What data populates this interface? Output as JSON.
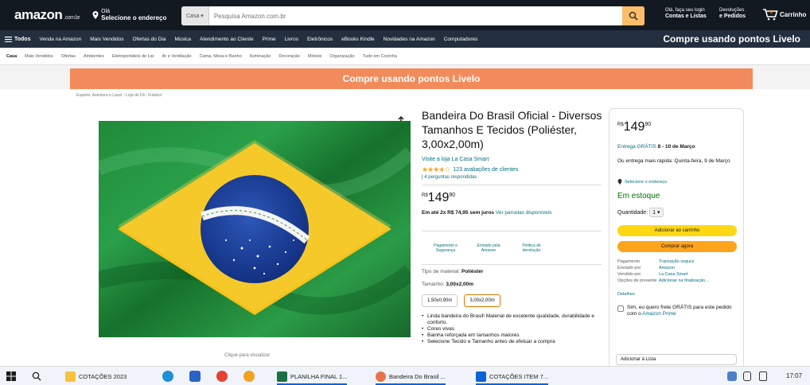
{
  "header": {
    "logo": "amazon",
    "logo_domain": ".com.br",
    "location_line1": "Olá",
    "location_line2": "Selecione o endereço",
    "search_category": "Casa",
    "search_placeholder": "Pesquisa Amazon.com.br",
    "account_line1": "Olá, faça seu login",
    "account_line2": "Contas e Listas",
    "orders_line1": "Devoluções",
    "orders_line2": "e Pedidos",
    "cart_count": "0",
    "cart_label": "Carrinho"
  },
  "nav": {
    "all_label": "Todos",
    "items": [
      "Venda na Amazon",
      "Mais Vendidos",
      "Ofertas do Dia",
      "Música",
      "Atendimento ao Cliente",
      "Prime",
      "Livros",
      "Eletrônicos",
      "eBooks Kindle",
      "Novidades na Amazon",
      "Computadores"
    ],
    "promo": "Compre usando pontos Livelo"
  },
  "subnav": {
    "items": [
      "Casa",
      "Mais Vendidos",
      "Ofertas",
      "Ambientes",
      "Eletroportáteis de Lar",
      "Ar e Ventilação",
      "Cama, Mesa e Banho",
      "Iluminação",
      "Decoração",
      "Móveis",
      "Organização",
      "Tudo em Cozinha"
    ]
  },
  "banner": "Compre usando pontos Livelo",
  "breadcrumb": "Esporte, Aventura e Lazer › Loja de Fã › Futebol",
  "image_caption": "Clique para visualizar",
  "product": {
    "title": "Bandeira Do Brasil Oficial - Diversos Tamanhos E Tecidos (Poliéster, 3,00x2,00m)",
    "store": "Visite a loja La Casa Smart",
    "stars": "★★★★☆",
    "reviews": "123 avaliações de clientes",
    "answers": "| 4 perguntas respondidas",
    "price_symbol": "R$",
    "price_int": "149",
    "price_cents": "90",
    "installments_bold": "Em até 2x R$ 74,95 sem juros",
    "installments_link": "Ver parcelas disponíveis",
    "badges": [
      "Pagamento e Segurança",
      "Enviado pela Amazon",
      "Política de devolução"
    ],
    "material_label": "Tipo de material:",
    "material_value": "Poliéster",
    "size_label": "Tamanho:",
    "size_value": "3,00x2,00m",
    "sizes": [
      "1,50x0,90m",
      "3,00x2,00m"
    ],
    "bullets": [
      "Linda bandeira do Brasil! Material de excelente qualidade, durabilidade e conforto.",
      "Cores vivas",
      "Bainha reforçada em tamanhos maiores",
      "Selecione Tecido e Tamanho antes de efetuar a compra"
    ]
  },
  "buybox": {
    "price_symbol": "R$",
    "price_int": "149",
    "price_cents": "90",
    "delivery_link": "Entrega GRÁTIS",
    "delivery_date": "8 - 10 de Março",
    "fast_delivery": "Ou entrega mais rápida: Quinta-feira, 9 de Março",
    "address": "Selecione o endereço",
    "stock": "Em estoque",
    "qty_label": "Quantidade:",
    "qty_value": "1",
    "add_to_cart": "Adicionar ao carrinho",
    "buy_now": "Comprar agora",
    "info": [
      {
        "k": "Pagamento",
        "v": "Transação segura"
      },
      {
        "k": "Enviado por",
        "v": "Amazon"
      },
      {
        "k": "Vendido por",
        "v": "La Casa Smart"
      },
      {
        "k": "Opções de presente",
        "v": "Adicionar na finalização..."
      }
    ],
    "details": "Detalhes",
    "prime_text": "Sim, eu quero frete GRÁTIS para este pedido com o",
    "prime_link": "Amazon Prime",
    "add_list": "Adicionar à Lista"
  },
  "taskbar": {
    "folder": "COTAÇÕES 2023",
    "excel": "PLANILHA FINAL 1...",
    "chrome": "Bandeira Do Brasil ...",
    "outlook": "COTAÇÕES ITEM 7...",
    "time": "17:07"
  }
}
